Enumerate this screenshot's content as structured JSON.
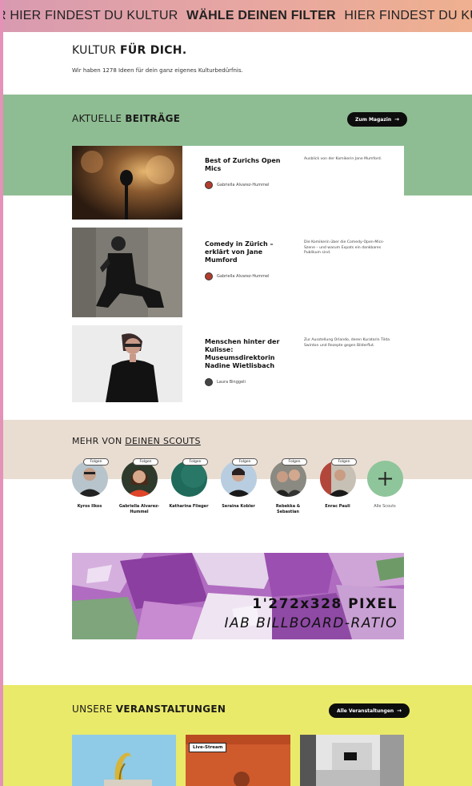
{
  "ticker": {
    "segments": [
      {
        "text": "R HIER FINDEST DU KULTUR",
        "strong": false
      },
      {
        "text": "WÄHLE DEINEN FILTER",
        "strong": true
      },
      {
        "text": "HIER FINDEST DU KULT",
        "strong": false
      }
    ]
  },
  "intro": {
    "title_light": "KULTUR ",
    "title_bold": "FÜR DICH.",
    "text": "Wir haben 1278 Ideen für dein ganz eigenes Kulturbedürfnis."
  },
  "articles_section": {
    "heading_light": "AKTUELLE ",
    "heading_bold": "BEITRÄGE",
    "cta_label": "Zum Magazin",
    "articles": [
      {
        "title": "Best of Zurichs Open Mics",
        "author": "Gabriella Alvarez-Hummel",
        "description": "Ausblick von der Komikerin Jane Mumford."
      },
      {
        "title": "Comedy in Zürich – erklärt von Jane Mumford",
        "author": "Gabriella Alvarez-Hummel",
        "description": "Die Komikerin über die Comedy-Open-Mics-Szene – und warum Expats ein dankbares Publikum sind."
      },
      {
        "title": "Menschen hinter der Kulisse: Museumsdirektorin Nadine Wietlisbach",
        "author": "Laura Binggeli",
        "description": "Zur Ausstellung Orlando, deren Kuratorin Tilda Swinton und Rezepte gegen Bilderflut."
      }
    ]
  },
  "scouts_section": {
    "heading_light": "MEHR VON ",
    "heading_link": "DEINEN SCOUTS",
    "follow_label": "Folgen",
    "scouts": [
      {
        "name": "Kyros Ilkos"
      },
      {
        "name": "Gabriella Alvarez-Hummel"
      },
      {
        "name": "Katharina Flieger"
      },
      {
        "name": "Seraina Kobler"
      },
      {
        "name": "Rebekka & Sebastian"
      },
      {
        "name": "Enrac Pauli"
      }
    ],
    "all_label": "Alle Scouts"
  },
  "billboard": {
    "line1": "1'272x328 PIXEL",
    "line2": "IAB BILLBOARD-RATIO"
  },
  "events_section": {
    "heading_light": "UNSERE ",
    "heading_bold": "VERANSTALTUNGEN",
    "cta_label": "Alle Veranstaltungen",
    "live_badge": "Live-Stream"
  },
  "colors": {
    "green_band": "#8fbd93",
    "beige_band": "#e9ddd2",
    "yellow_band": "#eaea6a",
    "pill": "#0d0d0d",
    "frame": "#e592b8"
  }
}
